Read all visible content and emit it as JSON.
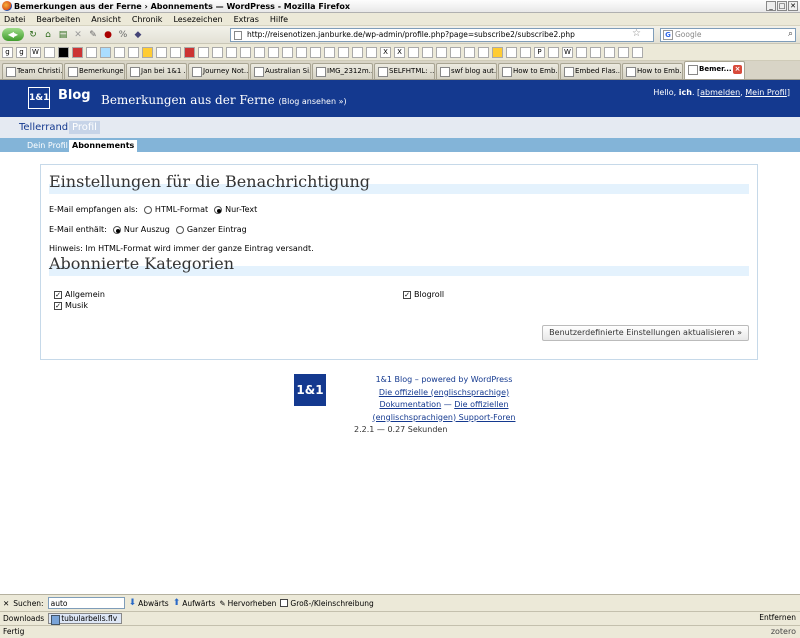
{
  "window": {
    "title": "Bemerkungen aus der Ferne › Abonnements — WordPress - Mozilla Firefox"
  },
  "menu": [
    "Datei",
    "Bearbeiten",
    "Ansicht",
    "Chronik",
    "Lesezeichen",
    "Extras",
    "Hilfe"
  ],
  "nav": {
    "url": "http://reisenotizen.janburke.de/wp-admin/profile.php?page=subscribe2/subscribe2.php",
    "search_placeholder": "Google"
  },
  "tabs": [
    {
      "label": "Team Christi..."
    },
    {
      "label": "Bemerkunge..."
    },
    {
      "label": "Jan bei 1&1 ..."
    },
    {
      "label": "Journey Not..."
    },
    {
      "label": "Australian Si..."
    },
    {
      "label": "IMG_2312m..."
    },
    {
      "label": "SELFHTML: ..."
    },
    {
      "label": "swf blog aut..."
    },
    {
      "label": "How to Emb..."
    },
    {
      "label": "Embed Flas..."
    },
    {
      "label": "How to Emb..."
    },
    {
      "label": "Bemer..."
    }
  ],
  "header": {
    "logo": "1&1",
    "blog_word": "Blog",
    "blog_title": "Bemerkungen aus der Ferne",
    "view_blog": "(Blog ansehen »)",
    "hello": "Hello,",
    "user": "ich",
    "logout": "abmelden",
    "profile": "Mein Profil"
  },
  "main_menu": {
    "item1": "Tellerrand",
    "item2": "Profil"
  },
  "sub_menu": {
    "item1": "Dein Profil",
    "item2": "Abonnements"
  },
  "settings": {
    "heading": "Einstellungen für die Benachrichtigung",
    "format_label": "E-Mail empfangen als:",
    "format_html": "HTML-Format",
    "format_text": "Nur-Text",
    "content_label": "E-Mail enthält:",
    "content_excerpt": "Nur Auszug",
    "content_full": "Ganzer Eintrag",
    "hint": "Hinweis: Im HTML-Format wird immer der ganze Eintrag versandt."
  },
  "categories": {
    "heading": "Abonnierte Kategorien",
    "items": [
      "Allgemein",
      "Musik",
      "Blogroll"
    ],
    "update_button": "Benutzerdefinierte Einstellungen aktualisieren »"
  },
  "footer": {
    "logo": "1&1",
    "line1": "1&1 Blog – powered by WordPress",
    "line2": "Die offizielle (englischsprachige)",
    "line3": "Dokumentation",
    "sep": "—",
    "line4": "Die offiziellen",
    "line5": "(englischsprachigen) Support-Foren",
    "version": "2.2.1 — 0.27 Sekunden"
  },
  "findbar": {
    "close": "✕",
    "label": "Suchen:",
    "value": "auto",
    "next": "Abwärts",
    "prev": "Aufwärts",
    "highlight": "Hervorheben",
    "matchcase": "Groß-/Kleinschreibung"
  },
  "downloads": {
    "label": "Downloads",
    "item": "tubularbells.flv",
    "remove": "Entfernen"
  },
  "status": {
    "text": "Fertig",
    "addon": "zotero"
  }
}
